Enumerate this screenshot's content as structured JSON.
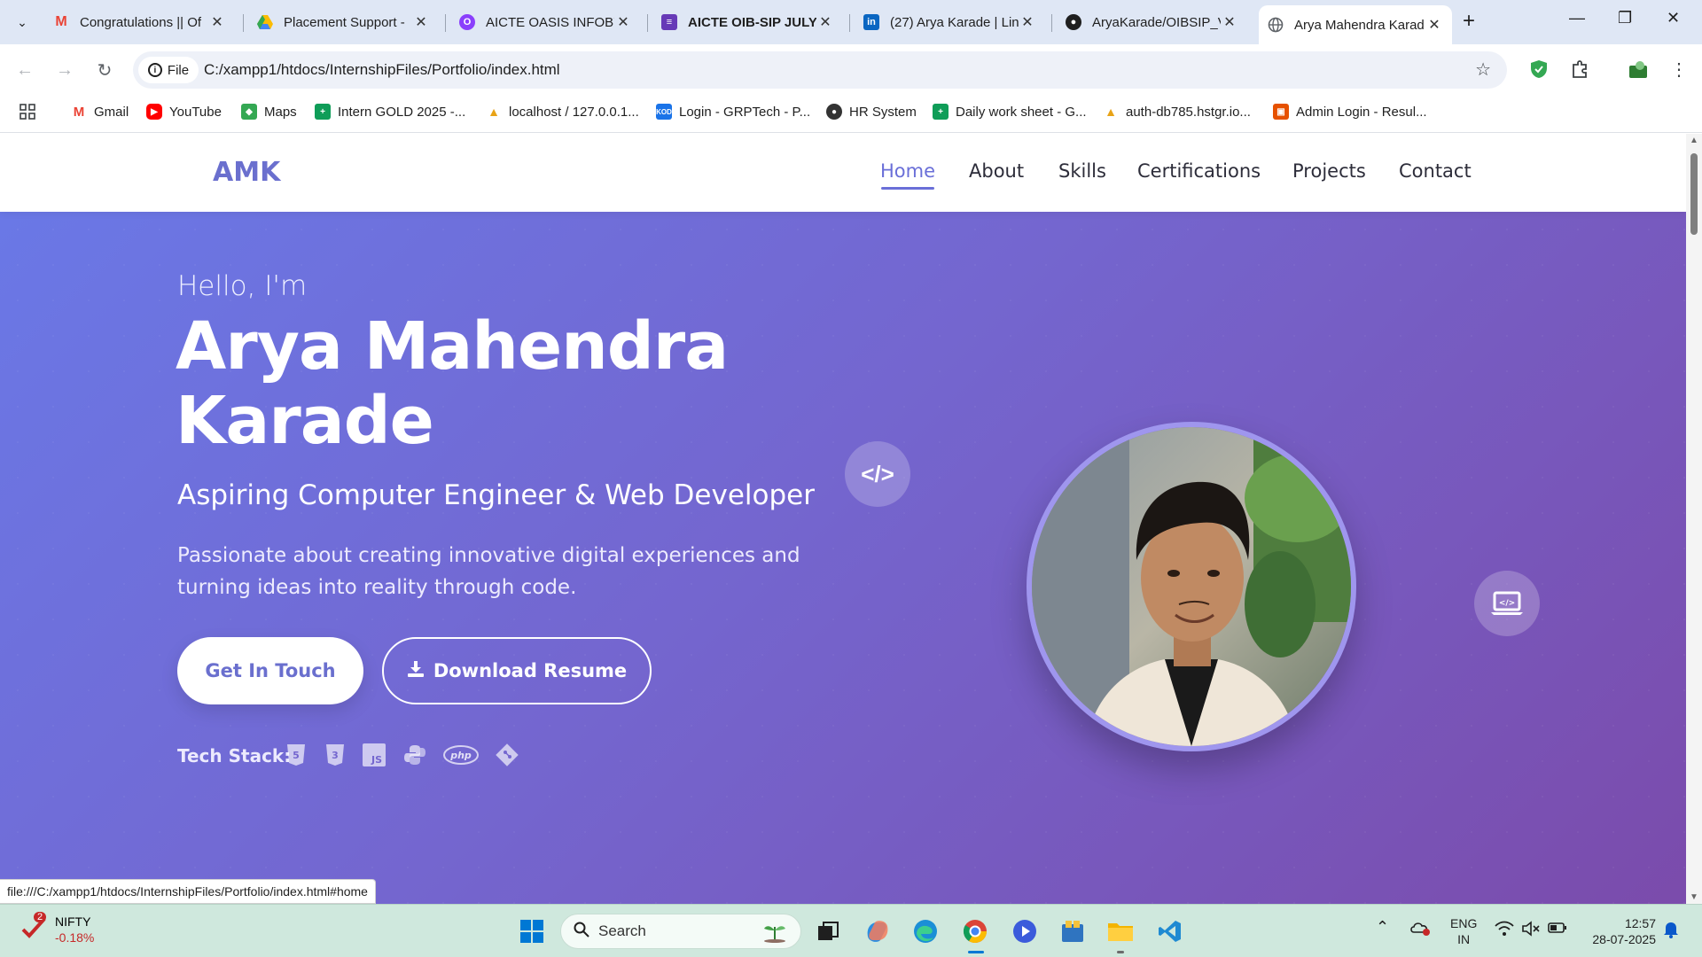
{
  "browser": {
    "tabs": [
      {
        "title": "Congratulations || Of",
        "favicon": "gmail-icon",
        "color": "#ea4335"
      },
      {
        "title": "Placement Support -",
        "favicon": "drive-icon",
        "color": "#34a853"
      },
      {
        "title": "AICTE OASIS INFOBY",
        "favicon": "oasis-icon",
        "color": "#8a3ffc"
      },
      {
        "title": "AICTE OIB-SIP JULY",
        "favicon": "forms-icon",
        "color": "#673ab7"
      },
      {
        "title": "(27) Arya Karade | Lin",
        "favicon": "linkedin-icon",
        "color": "#0a66c2"
      },
      {
        "title": "AryaKarade/OIBSIP_V",
        "favicon": "github-icon",
        "color": "#1f1f1f"
      },
      {
        "title": "Arya Mahendra Karad",
        "favicon": "globe-icon",
        "color": "#5f6368"
      }
    ],
    "address": {
      "chip": "File",
      "url": "C:/xampp1/htdocs/InternshipFiles/Portfolio/index.html"
    },
    "bookmarks": [
      {
        "label": "Gmail",
        "color": "#ea4335"
      },
      {
        "label": "YouTube",
        "color": "#ff0000"
      },
      {
        "label": "Maps",
        "color": "#34a853"
      },
      {
        "label": "Intern GOLD 2025 -...",
        "color": "#0f9d58"
      },
      {
        "label": "localhost / 127.0.0.1...",
        "color": "#e8a317"
      },
      {
        "label": "Login - GRPTech - P...",
        "color": "#1a73e8"
      },
      {
        "label": "HR System",
        "color": "#333333"
      },
      {
        "label": "Daily work sheet - G...",
        "color": "#0f9d58"
      },
      {
        "label": "auth-db785.hstgr.io...",
        "color": "#e8a317"
      },
      {
        "label": "Admin Login - Resul...",
        "color": "#e65100"
      }
    ],
    "status_url": "file:///C:/xampp1/htdocs/InternshipFiles/Portfolio/index.html#home"
  },
  "site": {
    "logo": "AMK",
    "nav": [
      "Home",
      "About",
      "Skills",
      "Certifications",
      "Projects",
      "Contact"
    ],
    "hero": {
      "greeting": "Hello, I'm",
      "name": "Arya Mahendra Karade",
      "role": "Aspiring Computer Engineer & Web Developer",
      "tagline": "Passionate about creating innovative digital experiences and turning ideas into reality through code.",
      "cta_primary": "Get In Touch",
      "cta_secondary": "Download Resume",
      "tech_stack_label": "Tech Stack:",
      "tech_stack_icons": [
        "html5-icon",
        "css3-icon",
        "js-icon",
        "python-icon",
        "php-icon",
        "git-icon"
      ]
    },
    "colors": {
      "accent": "#6a6fce",
      "gradient_start": "#6a78e6",
      "gradient_end": "#7b4bab"
    }
  },
  "taskbar": {
    "stock": {
      "name": "NIFTY",
      "change": "-0.18%",
      "badge": "2"
    },
    "search_placeholder": "Search",
    "language": "ENG",
    "region": "IN",
    "time": "12:57",
    "date": "28-07-2025"
  }
}
